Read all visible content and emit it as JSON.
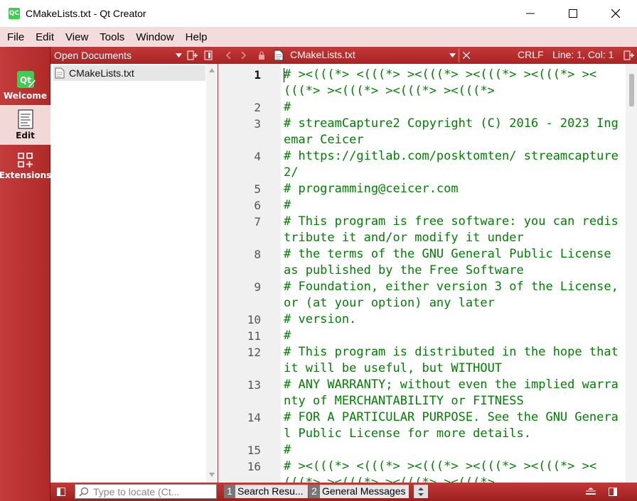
{
  "window": {
    "title": "CMakeLists.txt - Qt Creator",
    "app_icon_text": "QC",
    "minimize": "—",
    "maximize": "☐",
    "close": "✕"
  },
  "menu": [
    "File",
    "Edit",
    "View",
    "Tools",
    "Window",
    "Help"
  ],
  "modes": [
    {
      "label": "Welcome",
      "icon": "qt-logo-icon"
    },
    {
      "label": "Edit",
      "icon": "edit-document-icon"
    },
    {
      "label": "Extensions",
      "icon": "extensions-icon"
    }
  ],
  "open_documents": {
    "title": "Open Documents",
    "items": [
      "CMakeLists.txt"
    ]
  },
  "editor": {
    "file_name": "CMakeLists.txt",
    "line_ending": "CRLF",
    "cursor_position": "Line: 1, Col: 1",
    "lines": [
      {
        "num": "1",
        "text": "# ><(((*> <(((*> ><(((*> ><(((*> ><(((*> ><(((*> ><(((*> ><(((*> ><(((*>"
      },
      {
        "num": "2",
        "text": "#"
      },
      {
        "num": "3",
        "text": "# streamCapture2 Copyright (C) 2016 - 2023 Ingemar Ceicer"
      },
      {
        "num": "4",
        "text": "# https://gitlab.com/posktomten/ streamcapture2/"
      },
      {
        "num": "5",
        "text": "# programming@ceicer.com"
      },
      {
        "num": "6",
        "text": "#"
      },
      {
        "num": "7",
        "text": "# This program is free software: you can redistribute it and/or modify it under"
      },
      {
        "num": "8",
        "text": "# the terms of the GNU General Public License as published by the Free Software"
      },
      {
        "num": "9",
        "text": "# Foundation, either version 3 of the License, or (at your option) any later"
      },
      {
        "num": "10",
        "text": "# version."
      },
      {
        "num": "11",
        "text": "#"
      },
      {
        "num": "12",
        "text": "# This program is distributed in the hope that it will be useful, but WITHOUT"
      },
      {
        "num": "13",
        "text": "# ANY WARRANTY; without even the implied warranty of MERCHANTABILITY or FITNESS"
      },
      {
        "num": "14",
        "text": "# FOR A PARTICULAR PURPOSE. See the GNU General Public License for more details."
      },
      {
        "num": "15",
        "text": "#"
      },
      {
        "num": "16",
        "text": "# ><(((*> <(((*> ><(((*> ><(((*> ><(((*> ><(((*> ><(((*> ><(((*> ><(((*>"
      }
    ]
  },
  "statusbar": {
    "locator_placeholder": "Type to locate (Ct...",
    "panes": [
      {
        "num": "1",
        "label": "Search Resu..."
      },
      {
        "num": "2",
        "label": "General Messages"
      }
    ]
  },
  "colors": {
    "accent": "#b02a2a",
    "menubar": "#f5dcdc",
    "comment_green": "#008000"
  }
}
